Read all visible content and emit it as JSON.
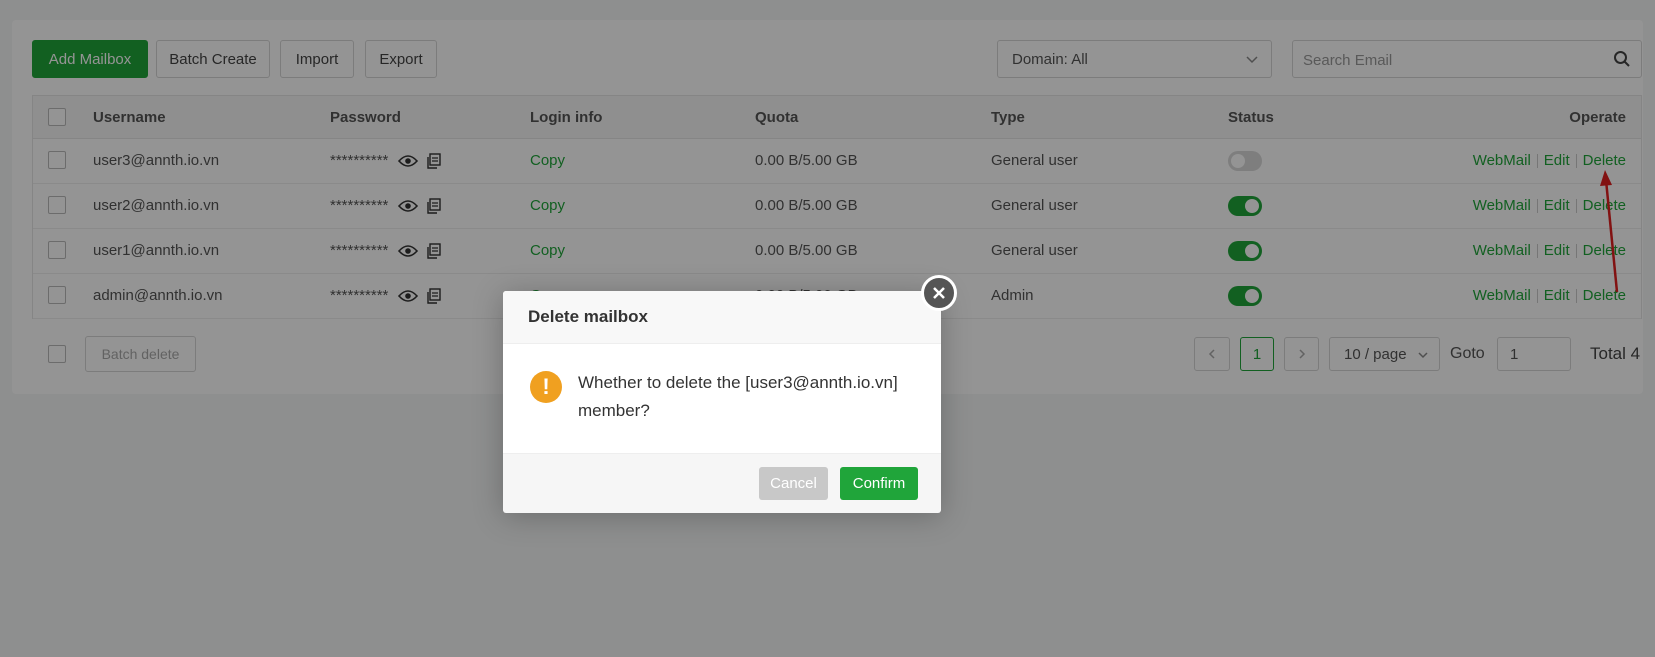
{
  "toolbar": {
    "add_label": "Add Mailbox",
    "batch_create_label": "Batch Create",
    "import_label": "Import",
    "export_label": "Export",
    "domain_select": "Domain: All",
    "search_placeholder": "Search Email"
  },
  "table": {
    "headers": {
      "username": "Username",
      "password": "Password",
      "login_info": "Login info",
      "quota": "Quota",
      "type": "Type",
      "status": "Status",
      "operate": "Operate"
    },
    "rows": [
      {
        "username": "user3@annth.io.vn",
        "password": "**********",
        "login": "Copy",
        "quota": "0.00 B/5.00 GB",
        "type": "General user",
        "status_enabled": false,
        "webmail": "WebMail",
        "edit": "Edit",
        "delete": "Delete"
      },
      {
        "username": "user2@annth.io.vn",
        "password": "**********",
        "login": "Copy",
        "quota": "0.00 B/5.00 GB",
        "type": "General user",
        "status_enabled": true,
        "webmail": "WebMail",
        "edit": "Edit",
        "delete": "Delete"
      },
      {
        "username": "user1@annth.io.vn",
        "password": "**********",
        "login": "Copy",
        "quota": "0.00 B/5.00 GB",
        "type": "General user",
        "status_enabled": true,
        "webmail": "WebMail",
        "edit": "Edit",
        "delete": "Delete"
      },
      {
        "username": "admin@annth.io.vn",
        "password": "**********",
        "login": "Copy",
        "quota": "0.00 B/5.00 GB",
        "type": "Admin",
        "status_enabled": true,
        "webmail": "WebMail",
        "edit": "Edit",
        "delete": "Delete"
      }
    ]
  },
  "footer": {
    "batch_delete_label": "Batch delete",
    "current_page": "1",
    "page_size": "10 / page",
    "goto_label": "Goto",
    "goto_value": "1",
    "total_label": "Total 4"
  },
  "dialog": {
    "title": "Delete mailbox",
    "message": "Whether to delete the [user3@annth.io.vn] member?",
    "cancel_label": "Cancel",
    "confirm_label": "Confirm",
    "warn_glyph": "!"
  },
  "colors": {
    "accent": "#20a53a",
    "warning": "#f0a020",
    "annotation_arrow": "#e02020"
  },
  "icons": [
    "search-icon",
    "chevron-down-icon",
    "eye-icon",
    "copy-icon",
    "chevron-left-icon",
    "chevron-right-icon",
    "close-icon",
    "warning-icon"
  ]
}
